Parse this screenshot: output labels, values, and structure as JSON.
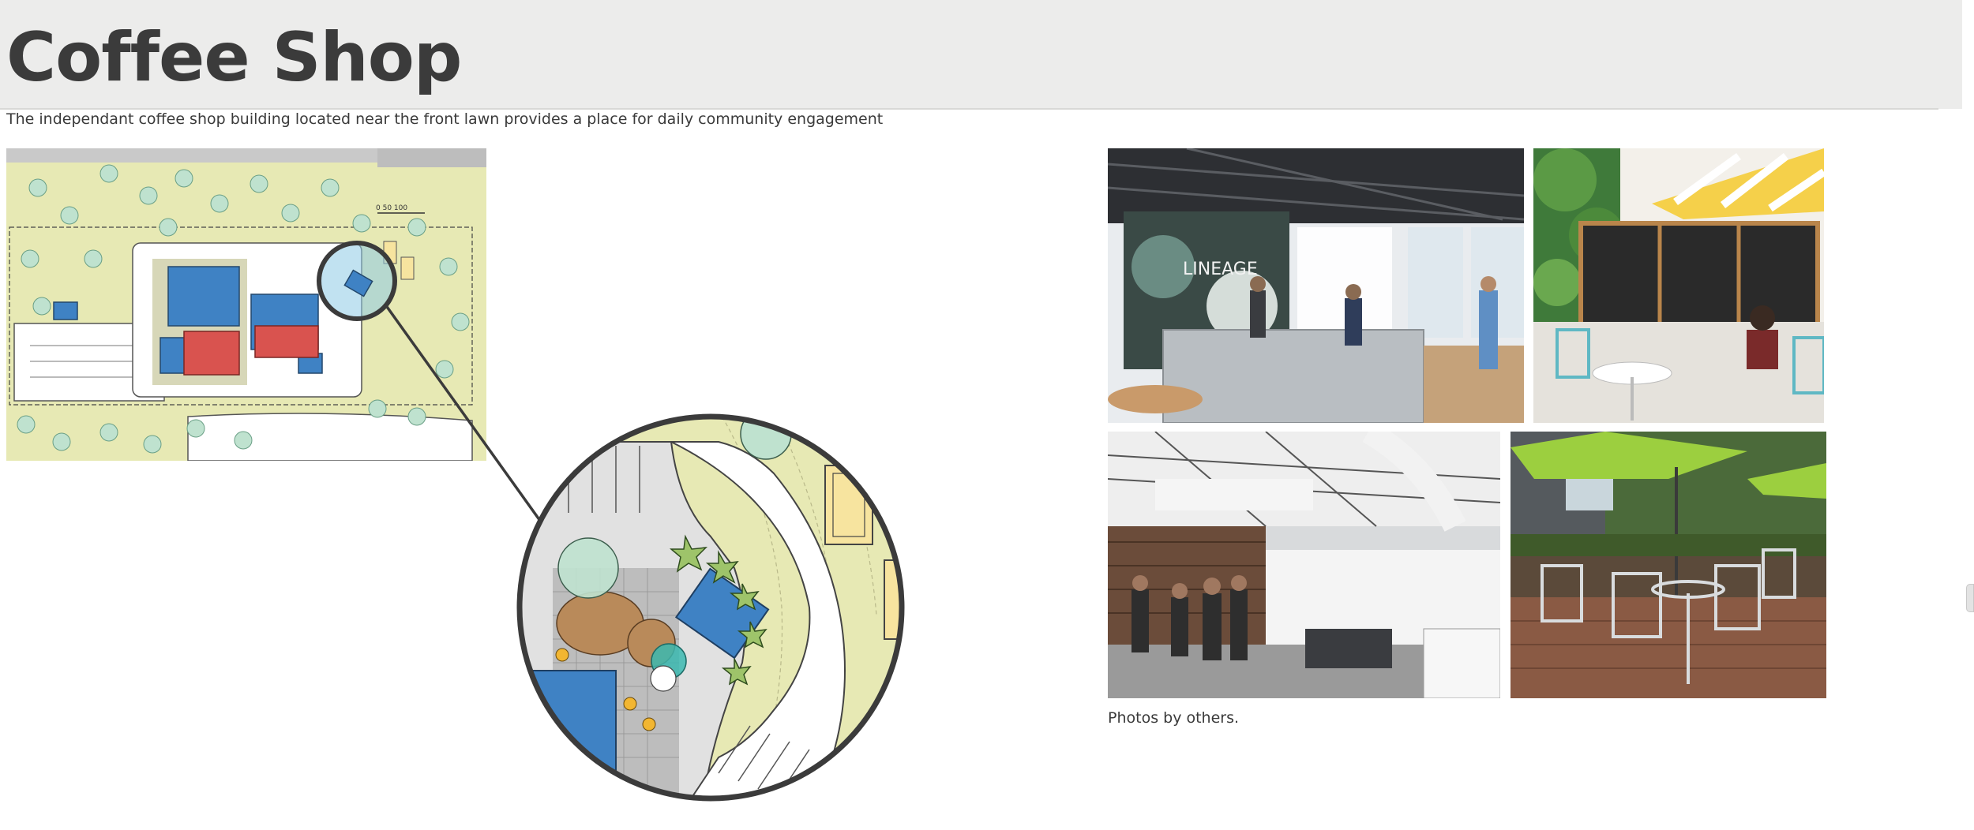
{
  "header": {
    "title": "Coffee Shop",
    "subtitle": "The independant coffee shop building located near the front lawn provides a place for daily community engagement"
  },
  "site_plan": {
    "scale_label": "0  50  100"
  },
  "photos": [
    {
      "name": "coffee-bar-interior",
      "sign_text": "LINEAGE"
    },
    {
      "name": "walk-up-window-patio"
    },
    {
      "name": "open-warehouse-cafe"
    },
    {
      "name": "outdoor-umbrella-seating"
    }
  ],
  "caption": "Photos by others.",
  "colors": {
    "header_band": "#ececeb",
    "lawn": "#e7e9b4",
    "building_blue": "#3f82c4",
    "building_red": "#d9534f",
    "tree": "#bfe2cf",
    "outline": "#3b3b3b"
  }
}
